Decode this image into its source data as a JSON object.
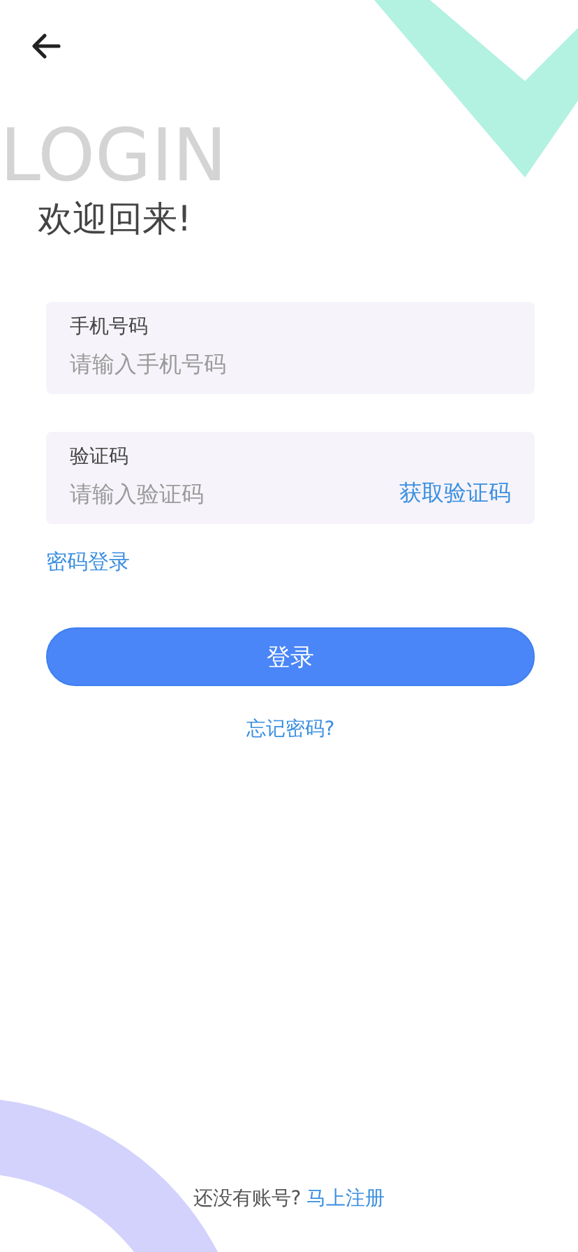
{
  "header": {
    "watermark": "LOGIN",
    "title": "欢迎回来!"
  },
  "fields": [
    {
      "kind": "plain",
      "label": "手机号码",
      "placeholder": "请输入手机号码"
    },
    {
      "kind": "code",
      "label": "验证码",
      "placeholder": "请输入验证码",
      "action": "获取验证码"
    }
  ],
  "switch_link": "密码登录",
  "submit": "登录",
  "forgot": "忘记密码?",
  "footer": {
    "text": "还没有账号?",
    "link": "马上注册"
  }
}
